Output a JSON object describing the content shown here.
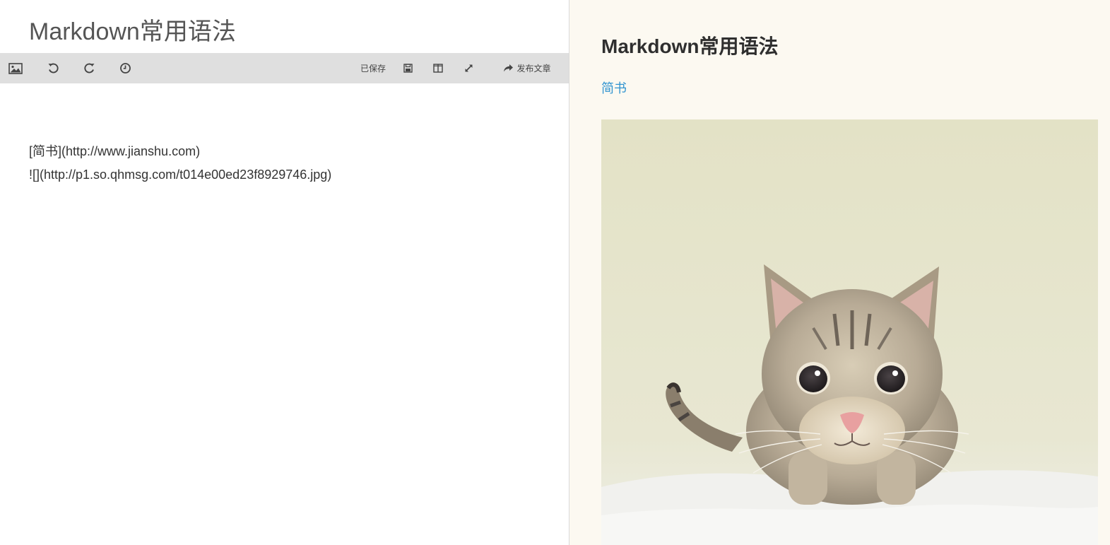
{
  "editor": {
    "title": "Markdown常用语法",
    "toolbar": {
      "image_icon": "image-icon",
      "undo_icon": "undo-icon",
      "redo_icon": "redo-icon",
      "history_icon": "history-clock-icon",
      "saved_label": "已保存",
      "save_icon": "save-floppy-icon",
      "split_icon": "split-view-icon",
      "fullscreen_icon": "expand-icon",
      "publish_icon": "share-arrow-icon",
      "publish_label": "发布文章"
    },
    "lines": [
      "[简书](http://www.jianshu.com)",
      "![](http://p1.so.qhmsg.com/t014e00ed23f8929746.jpg)"
    ]
  },
  "preview": {
    "title": "Markdown常用语法",
    "link_text": "简书",
    "link_color": "#3194d0",
    "image_subject": "cat photo"
  },
  "colors": {
    "toolbar_bg": "#dfdfdf",
    "preview_bg": "#fcf9f1",
    "title_color": "#555555"
  }
}
